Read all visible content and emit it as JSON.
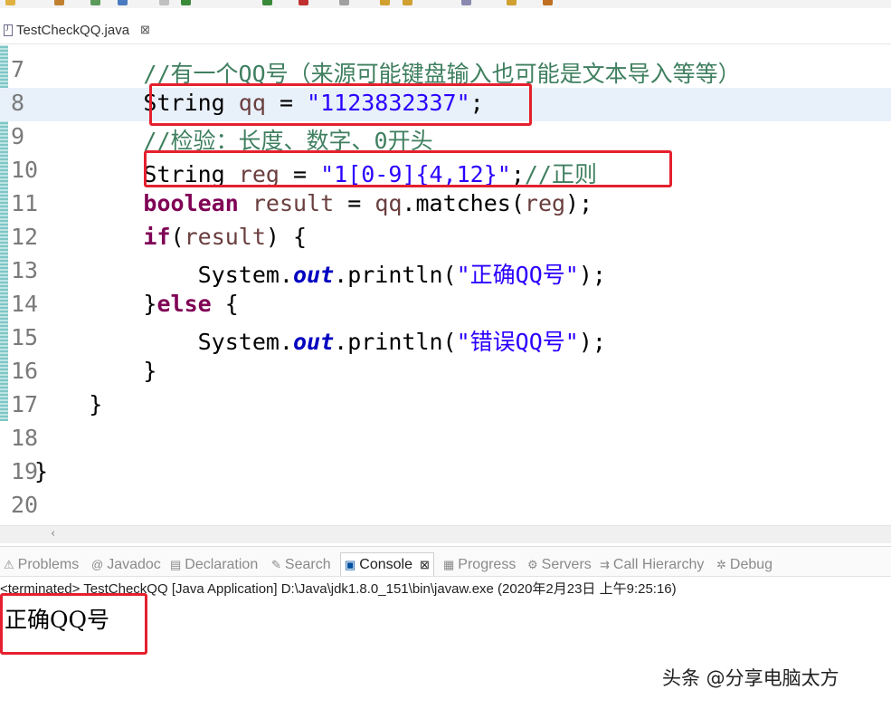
{
  "editor_tab": {
    "label": "TestCheckQQ.java",
    "close": "⊠"
  },
  "code_lines": [
    {
      "no": "7",
      "parts": [
        {
          "t": "        //有一个QQ号（来源可能键盘输入也可能是文本导入等等）",
          "c": "cm"
        }
      ]
    },
    {
      "no": "8",
      "parts": [
        {
          "t": "        String ",
          "c": ""
        },
        {
          "t": "qq",
          "c": "var"
        },
        {
          "t": " = ",
          "c": ""
        },
        {
          "t": "\"1123832337\"",
          "c": "str"
        },
        {
          "t": ";",
          "c": ""
        }
      ]
    },
    {
      "no": "9",
      "parts": [
        {
          "t": "        //检验：长度、数字、0开头",
          "c": "cm"
        }
      ]
    },
    {
      "no": "10",
      "parts": [
        {
          "t": "        String ",
          "c": ""
        },
        {
          "t": "reg",
          "c": "var"
        },
        {
          "t": " = ",
          "c": ""
        },
        {
          "t": "\"1[0-9]{4,12}\"",
          "c": "str"
        },
        {
          "t": ";",
          "c": ""
        },
        {
          "t": "//正则",
          "c": "cm"
        }
      ]
    },
    {
      "no": "11",
      "parts": [
        {
          "t": "        ",
          "c": ""
        },
        {
          "t": "boolean",
          "c": "kw"
        },
        {
          "t": " ",
          "c": ""
        },
        {
          "t": "result",
          "c": "var"
        },
        {
          "t": " = ",
          "c": ""
        },
        {
          "t": "qq",
          "c": "var"
        },
        {
          "t": ".matches(",
          "c": ""
        },
        {
          "t": "reg",
          "c": "var"
        },
        {
          "t": ");",
          "c": ""
        }
      ]
    },
    {
      "no": "12",
      "parts": [
        {
          "t": "        ",
          "c": ""
        },
        {
          "t": "if",
          "c": "kw"
        },
        {
          "t": "(",
          "c": ""
        },
        {
          "t": "result",
          "c": "var"
        },
        {
          "t": ") {",
          "c": ""
        }
      ]
    },
    {
      "no": "13",
      "parts": [
        {
          "t": "            System.",
          "c": ""
        },
        {
          "t": "out",
          "c": "stat"
        },
        {
          "t": ".println(",
          "c": ""
        },
        {
          "t": "\"正确QQ号\"",
          "c": "str"
        },
        {
          "t": ");",
          "c": ""
        }
      ]
    },
    {
      "no": "14",
      "parts": [
        {
          "t": "        }",
          "c": ""
        },
        {
          "t": "else",
          "c": "kw"
        },
        {
          "t": " {",
          "c": ""
        }
      ]
    },
    {
      "no": "15",
      "parts": [
        {
          "t": "            System.",
          "c": ""
        },
        {
          "t": "out",
          "c": "stat"
        },
        {
          "t": ".println(",
          "c": ""
        },
        {
          "t": "\"错误QQ号\"",
          "c": "str"
        },
        {
          "t": ");",
          "c": ""
        }
      ]
    },
    {
      "no": "16",
      "parts": [
        {
          "t": "        }",
          "c": ""
        }
      ]
    },
    {
      "no": "17",
      "parts": [
        {
          "t": "    }",
          "c": ""
        }
      ]
    },
    {
      "no": "18",
      "parts": []
    },
    {
      "no": "19",
      "parts": [
        {
          "t": "}",
          "c": ""
        }
      ]
    },
    {
      "no": "20",
      "parts": []
    }
  ],
  "panel_tabs": [
    {
      "label": "Problems",
      "icon": "problems-icon",
      "glyph": "⚠",
      "active": false
    },
    {
      "label": "Javadoc",
      "icon": "javadoc-icon",
      "glyph": "@",
      "active": false
    },
    {
      "label": "Declaration",
      "icon": "declaration-icon",
      "glyph": "▤",
      "active": false
    },
    {
      "label": "Search",
      "icon": "search-icon",
      "glyph": "✎",
      "active": false
    },
    {
      "label": "Console",
      "icon": "console-icon",
      "glyph": "▣",
      "active": true,
      "close": "⊠"
    },
    {
      "label": "Progress",
      "icon": "progress-icon",
      "glyph": "▦",
      "active": false
    },
    {
      "label": "Servers",
      "icon": "servers-icon",
      "glyph": "⚙",
      "active": false
    },
    {
      "label": "Call Hierarchy",
      "icon": "call-hierarchy-icon",
      "glyph": "⇉",
      "active": false
    },
    {
      "label": "Debug",
      "icon": "debug-icon",
      "glyph": "✲",
      "active": false
    }
  ],
  "console": {
    "header": "<terminated> TestCheckQQ [Java Application] D:\\Java\\jdk1.8.0_151\\bin\\javaw.exe (2020年2月23日 上午9:25:16)",
    "output": "正确QQ号"
  },
  "watermark": "头条 @分享电脑太方",
  "colors": {
    "highlight_box": "#e5202e",
    "current_line": "#e8f0fa",
    "keyword": "#7f0055",
    "string": "#2a00ff",
    "comment": "#3f7f5f"
  }
}
